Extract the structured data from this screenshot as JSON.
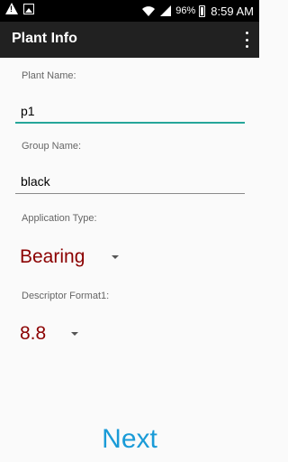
{
  "status_bar": {
    "battery": "96%",
    "time": "8:59 AM"
  },
  "app_bar": {
    "title": "Plant Info"
  },
  "form": {
    "plant_name": {
      "label": "Plant Name:",
      "value": "p1"
    },
    "group_name": {
      "label": "Group Name:",
      "value": "black"
    },
    "application_type": {
      "label": "Application Type:",
      "selected": "Bearing"
    },
    "descriptor_format": {
      "label": "Descriptor Format1:",
      "selected": "8.8"
    }
  },
  "actions": {
    "next_label": "Next"
  },
  "colors": {
    "accent": "#26a69a",
    "spinner_text": "#8b0000",
    "next": "#1a9bd7",
    "app_bar": "#212121"
  }
}
